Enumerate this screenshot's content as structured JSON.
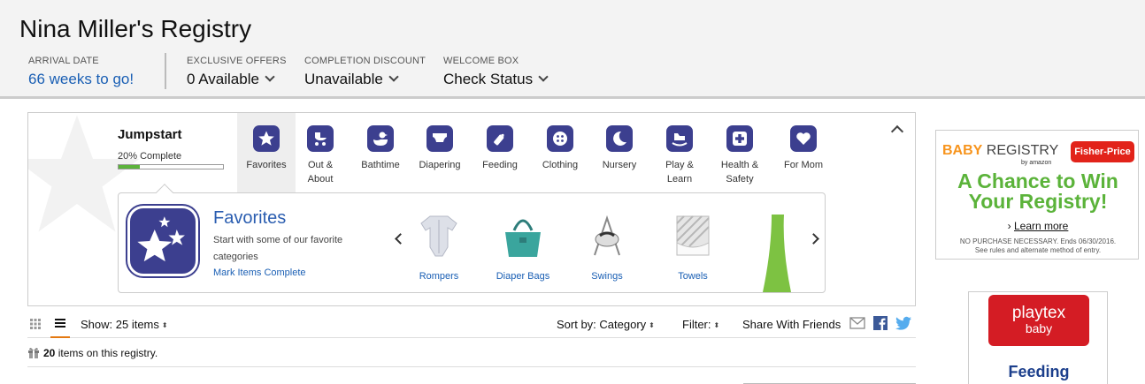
{
  "header": {
    "title": "Nina Miller's Registry",
    "arrival": {
      "label": "ARRIVAL DATE",
      "value": "66 weeks to go!"
    },
    "offers": {
      "label": "EXCLUSIVE OFFERS",
      "value": "0 Available"
    },
    "discount": {
      "label": "COMPLETION DISCOUNT",
      "value": "Unavailable"
    },
    "welcome": {
      "label": "WELCOME BOX",
      "value": "Check Status"
    }
  },
  "jumpstart": {
    "title": "Jumpstart",
    "progress_text": "20% Complete",
    "progress_fraction": 0.2,
    "categories": [
      {
        "label1": "Favorites",
        "label2": "",
        "icon": "star-icon",
        "active": true
      },
      {
        "label1": "Out &",
        "label2": "About",
        "icon": "stroller-icon",
        "active": false
      },
      {
        "label1": "Bathtime",
        "label2": "",
        "icon": "duck-icon",
        "active": false
      },
      {
        "label1": "Diapering",
        "label2": "",
        "icon": "diaper-icon",
        "active": false
      },
      {
        "label1": "Feeding",
        "label2": "",
        "icon": "bottle-icon",
        "active": false
      },
      {
        "label1": "Clothing",
        "label2": "",
        "icon": "button-icon",
        "active": false
      },
      {
        "label1": "Nursery",
        "label2": "",
        "icon": "moon-icon",
        "active": false
      },
      {
        "label1": "Play &",
        "label2": "Learn",
        "icon": "rocking-horse-icon",
        "active": false
      },
      {
        "label1": "Health &",
        "label2": "Safety",
        "icon": "medical-cross-icon",
        "active": false
      },
      {
        "label1": "For Mom",
        "label2": "",
        "icon": "heart-icon",
        "active": false
      }
    ],
    "favorites": {
      "title": "Favorites",
      "description": "Start with some of our favorite categories",
      "mark_complete": "Mark Items Complete",
      "products": [
        "Rompers",
        "Diaper Bags",
        "Swings",
        "Towels"
      ]
    }
  },
  "toolbar": {
    "show": "Show: 25 items",
    "sort_label": "Sort by:",
    "sort_value": "Category",
    "filter": "Filter:",
    "share": "Share With Friends"
  },
  "summary": {
    "count": "20",
    "text": "items on this registry."
  },
  "ads": {
    "ad1": {
      "brand_baby": "BABY",
      "brand_registry": "REGISTRY",
      "by_amazon": "by amazon",
      "partner": "Fisher-Price",
      "headline1": "A Chance to Win",
      "headline2": "Your Registry!",
      "learn_more": "Learn more",
      "fine1": "NO PURCHASE NECESSARY. Ends 06/30/2016.",
      "fine2": "See rules and alternate method of entry."
    },
    "ad2": {
      "logo1": "playtex",
      "logo2": "baby",
      "caption": "Feeding"
    }
  },
  "colors": {
    "accent_purple": "#3c3f8f",
    "link_blue": "#1a5fb4",
    "progress_green": "#5bb33a",
    "tab_orange": "#e47911",
    "facebook": "#3b5998",
    "twitter": "#55acee"
  }
}
